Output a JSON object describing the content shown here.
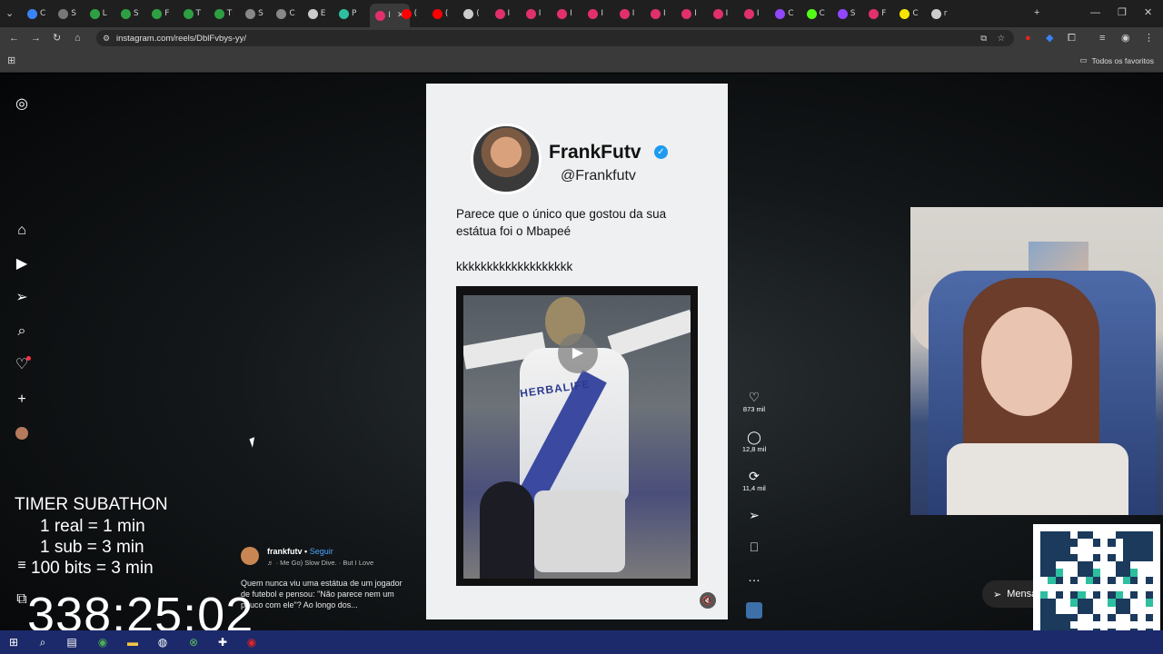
{
  "browser": {
    "tabs": [
      {
        "label": "C",
        "color": "#3b82f6"
      },
      {
        "label": "S",
        "color": "#777777"
      },
      {
        "label": "L",
        "color": "#2ea043"
      },
      {
        "label": "S",
        "color": "#2ea043"
      },
      {
        "label": "F",
        "color": "#2ea043"
      },
      {
        "label": "T",
        "color": "#2ea043"
      },
      {
        "label": "T",
        "color": "#2ea043"
      },
      {
        "label": "S",
        "color": "#888888"
      },
      {
        "label": "C",
        "color": "#888888"
      },
      {
        "label": "E",
        "color": "#cccccc"
      },
      {
        "label": "P",
        "color": "#2dbfa0"
      },
      {
        "label": "I",
        "color": "#e1306c"
      },
      {
        "label": "(",
        "color": "#ff0000"
      },
      {
        "label": "(",
        "color": "#ff0000"
      },
      {
        "label": "(",
        "color": "#cccccc"
      },
      {
        "label": "I",
        "color": "#e1306c"
      },
      {
        "label": "I",
        "color": "#e1306c"
      },
      {
        "label": "I",
        "color": "#e1306c"
      },
      {
        "label": "I",
        "color": "#e1306c"
      },
      {
        "label": "I",
        "color": "#e1306c"
      },
      {
        "label": "I",
        "color": "#e1306c"
      },
      {
        "label": "I",
        "color": "#e1306c"
      },
      {
        "label": "I",
        "color": "#e1306c"
      },
      {
        "label": "I",
        "color": "#e1306c"
      },
      {
        "label": "C",
        "color": "#9146ff"
      },
      {
        "label": "C",
        "color": "#53fc18"
      },
      {
        "label": "S",
        "color": "#9146ff"
      },
      {
        "label": "F",
        "color": "#e1306c"
      },
      {
        "label": "C",
        "color": "#f7e600"
      },
      {
        "label": "r",
        "color": "#cccccc"
      }
    ],
    "active_tab_index": 11,
    "url": "instagram.com/reels/DblFvbys-yy/",
    "bookmarks_label": "Todos os favoritos"
  },
  "post": {
    "display_name": "FrankFutv",
    "handle": "@Frankfutv",
    "text_line1": "Parece que o único que gostou da sua",
    "text_line2": "estátua foi o Mbapeé",
    "text_line3": "kkkkkkkkkkkkkkkkkkk",
    "video_jersey_text": "HERBALIFE"
  },
  "actions": {
    "likes": "873 mil",
    "comments": "12,8 mil",
    "reposts": "11,4 mil"
  },
  "caption": {
    "username": "frankfutv",
    "separator": "•",
    "follow": "Seguir",
    "music": "♬  · Me Go)  Slow Dive. · But I Love",
    "text": "Quem nunca viu uma estátua de um jogador de futebol e pensou: \"Não parece nem um pouco com ele\"? Ao longo dos..."
  },
  "messages_button": "Mensagens",
  "overlay": {
    "title": "TIMER SUBATHON",
    "rule1": "1 real = 1 min",
    "rule2": "1 sub = 3 min",
    "rule3": "100 bits = 3 min",
    "timer": "338:25:02"
  },
  "icons": {
    "instagram": "instagram-logo-icon",
    "home": "home-icon",
    "reels": "reels-icon",
    "messages": "send-icon",
    "search": "search-icon",
    "notifications": "heart-icon",
    "create": "plus-icon",
    "profile": "avatar"
  }
}
